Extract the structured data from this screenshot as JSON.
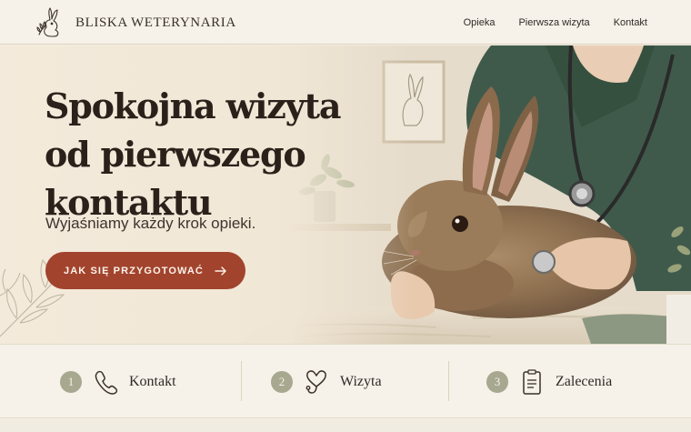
{
  "brand": {
    "name": "BLISKA WETERYNARIA",
    "logo_icon": "rabbit-logo-icon"
  },
  "nav": {
    "items": [
      "Opieka",
      "Pierwsza wizyta",
      "Kontakt"
    ]
  },
  "hero": {
    "title_lines": [
      "Spokojna wizyta",
      "od pierwszego",
      "kontaktu"
    ],
    "subtitle": "Wyjaśniamy każdy krok opieki.",
    "cta_label": "JAK SIĘ PRZYGOTOWAĆ",
    "cta_icon": "arrow-right-icon"
  },
  "steps": [
    {
      "number": "1",
      "label": "Kontakt",
      "icon": "phone-icon"
    },
    {
      "number": "2",
      "label": "Wizyta",
      "icon": "stethoscope-heart-icon"
    },
    {
      "number": "3",
      "label": "Zalecenia",
      "icon": "clipboard-icon"
    }
  ],
  "colors": {
    "accent": "#a2432d",
    "background": "#f4efe4",
    "step_badge": "#a7a88f",
    "scrubs": "#3f5a4b"
  }
}
